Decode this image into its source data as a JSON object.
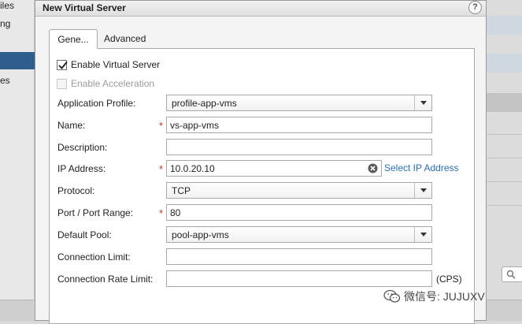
{
  "background": {
    "left_labels": [
      "iles",
      "ng",
      "es"
    ]
  },
  "dialog": {
    "title": "New Virtual Server",
    "help_glyph": "?",
    "tabs": [
      {
        "label": "Gene...",
        "active": true
      },
      {
        "label": "Advanced",
        "active": false
      }
    ],
    "enable_virtual_server": {
      "label": "Enable Virtual Server",
      "checked": true
    },
    "enable_acceleration": {
      "label": "Enable Acceleration",
      "checked": false,
      "disabled": true
    },
    "fields": {
      "application_profile": {
        "label": "Application Profile:",
        "value": "profile-app-vms"
      },
      "name": {
        "label": "Name:",
        "value": "vs-app-vms",
        "required": "*"
      },
      "description": {
        "label": "Description:",
        "value": ""
      },
      "ip_address": {
        "label": "IP Address:",
        "value": "10.0.20.10",
        "required": "*",
        "link": "Select IP Address"
      },
      "protocol": {
        "label": "Protocol:",
        "value": "TCP"
      },
      "port": {
        "label": "Port / Port Range:",
        "value": "80",
        "required": "*"
      },
      "default_pool": {
        "label": "Default Pool:",
        "value": "pool-app-vms"
      },
      "connection_limit": {
        "label": "Connection Limit:",
        "value": ""
      },
      "connection_rate_limit": {
        "label": "Connection Rate Limit:",
        "value": "",
        "suffix": "(CPS)"
      }
    }
  },
  "watermark": {
    "text": "微信号: JUJUXV"
  },
  "icons": {
    "help": "help-icon",
    "check": "checkmark-icon",
    "dropdown": "dropdown-arrow-icon",
    "clear": "clear-icon",
    "search": "search-icon",
    "wechat": "wechat-icon"
  }
}
